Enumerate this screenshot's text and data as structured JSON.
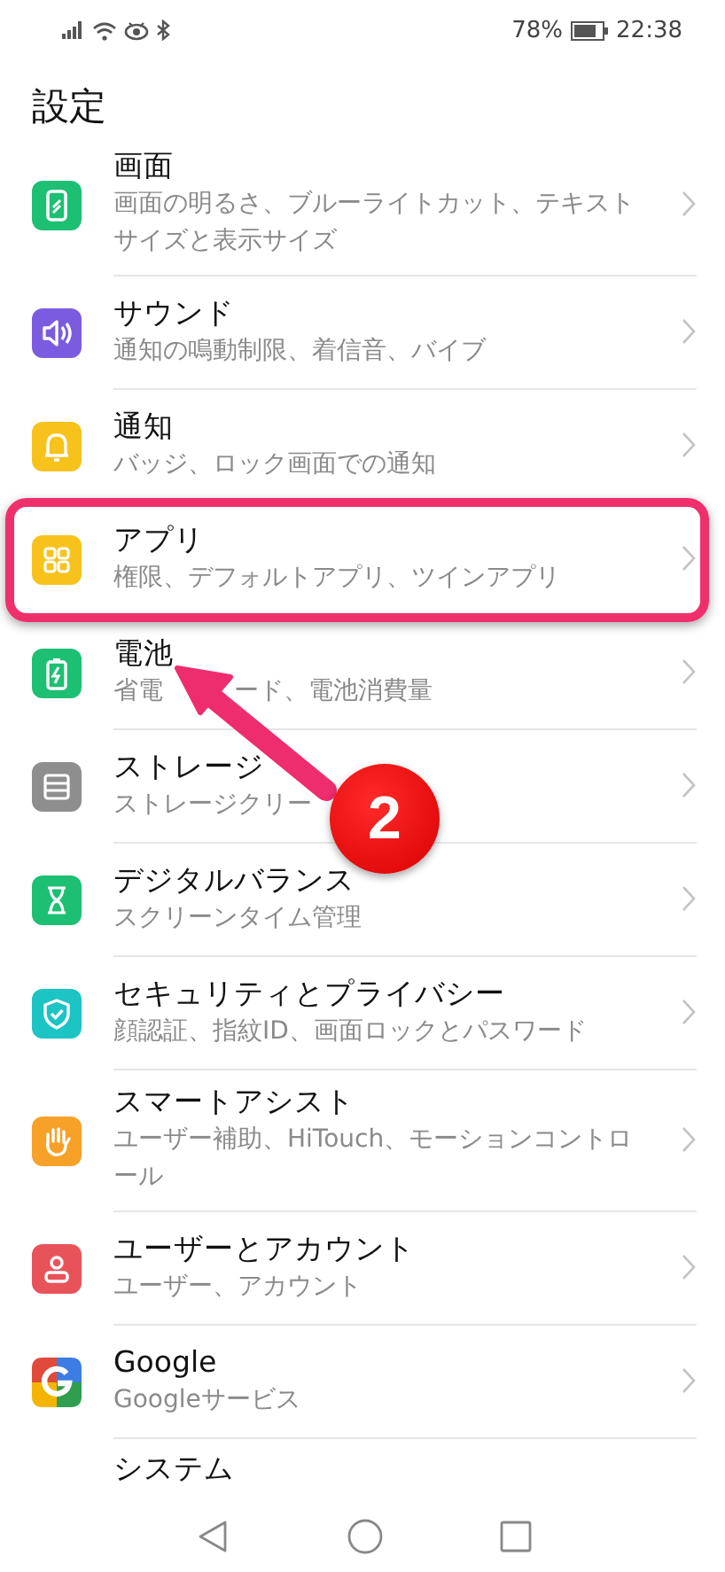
{
  "status_bar": {
    "battery_percent": "78%",
    "time": "22:38"
  },
  "title": "設定",
  "items": [
    {
      "kind": "display",
      "title": "画面",
      "subtitle": [
        "画面の明るさ、ブルーライトカット、テキストサイズと表示サイズ"
      ],
      "highlighted": false
    },
    {
      "kind": "sound",
      "title": "サウンド",
      "subtitle": [
        "通知の鳴動制限、着信音、バイブ"
      ],
      "highlighted": false
    },
    {
      "kind": "notification",
      "title": "通知",
      "subtitle": [
        "バッジ、ロック画面での通知"
      ],
      "highlighted": false
    },
    {
      "kind": "apps",
      "title": "アプリ",
      "subtitle": [
        "権限、デフォルトアプリ、ツインアプリ"
      ],
      "highlighted": true
    },
    {
      "kind": "battery",
      "title": "電池",
      "subtitle": [
        "省電",
        "ード、電池消費量"
      ],
      "highlighted": false
    },
    {
      "kind": "storage",
      "title": "ストレージ",
      "subtitle": [
        "ストレージクリー"
      ],
      "highlighted": false
    },
    {
      "kind": "digital_balance",
      "title": "デジタルバランス",
      "subtitle": [
        "スクリーンタイム管理"
      ],
      "highlighted": false
    },
    {
      "kind": "security",
      "title": "セキュリティとプライバシー",
      "subtitle": [
        "顔認証、指紋ID、画面ロックとパスワード"
      ],
      "highlighted": false
    },
    {
      "kind": "smart_assist",
      "title": "スマートアシスト",
      "subtitle": [
        "ユーザー補助、HiTouch、モーションコントロール"
      ],
      "highlighted": false
    },
    {
      "kind": "users",
      "title": "ユーザーとアカウント",
      "subtitle": [
        "ユーザー、アカウント"
      ],
      "highlighted": false
    },
    {
      "kind": "google",
      "title": "Google",
      "subtitle": [
        "Googleサービス"
      ],
      "highlighted": false
    },
    {
      "kind": "partial",
      "title": "システム",
      "highlighted": false
    }
  ],
  "annotation": {
    "badge": "2"
  }
}
